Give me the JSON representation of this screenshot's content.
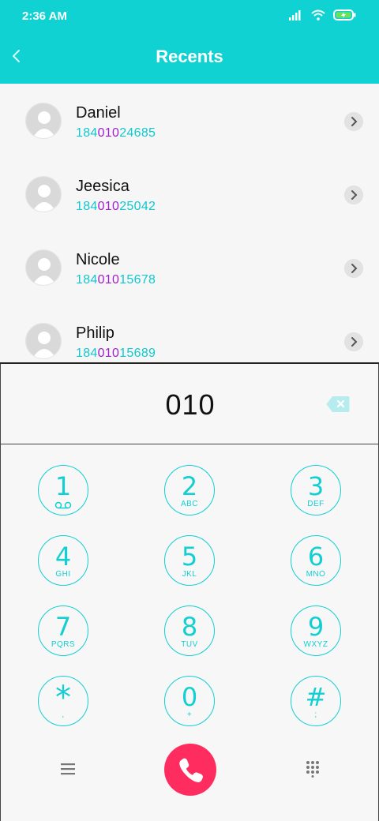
{
  "status": {
    "time": "2:36 AM"
  },
  "header": {
    "title": "Recents"
  },
  "contacts": [
    {
      "name": "Daniel",
      "num_pre": "184",
      "num_match": "010",
      "num_post": "24685"
    },
    {
      "name": "Jeesica",
      "num_pre": "184",
      "num_match": "010",
      "num_post": "25042"
    },
    {
      "name": "Nicole",
      "num_pre": "184",
      "num_match": "010",
      "num_post": "15678"
    },
    {
      "name": "Philip",
      "num_pre": "184",
      "num_match": "010",
      "num_post": "15689"
    }
  ],
  "dialer": {
    "dialed": "010"
  },
  "keys": [
    {
      "digit": "1",
      "letters": ""
    },
    {
      "digit": "2",
      "letters": "ABC"
    },
    {
      "digit": "3",
      "letters": "DEF"
    },
    {
      "digit": "4",
      "letters": "GHI"
    },
    {
      "digit": "5",
      "letters": "JKL"
    },
    {
      "digit": "6",
      "letters": "MNO"
    },
    {
      "digit": "7",
      "letters": "PQRS"
    },
    {
      "digit": "8",
      "letters": "TUV"
    },
    {
      "digit": "9",
      "letters": "WXYZ"
    },
    {
      "digit": "*",
      "letters": ","
    },
    {
      "digit": "0",
      "letters": "+"
    },
    {
      "digit": "#",
      "letters": ";"
    }
  ],
  "colors": {
    "accent": "#10d2d2",
    "highlight": "#a21ecd",
    "call": "#ff2d5f"
  }
}
